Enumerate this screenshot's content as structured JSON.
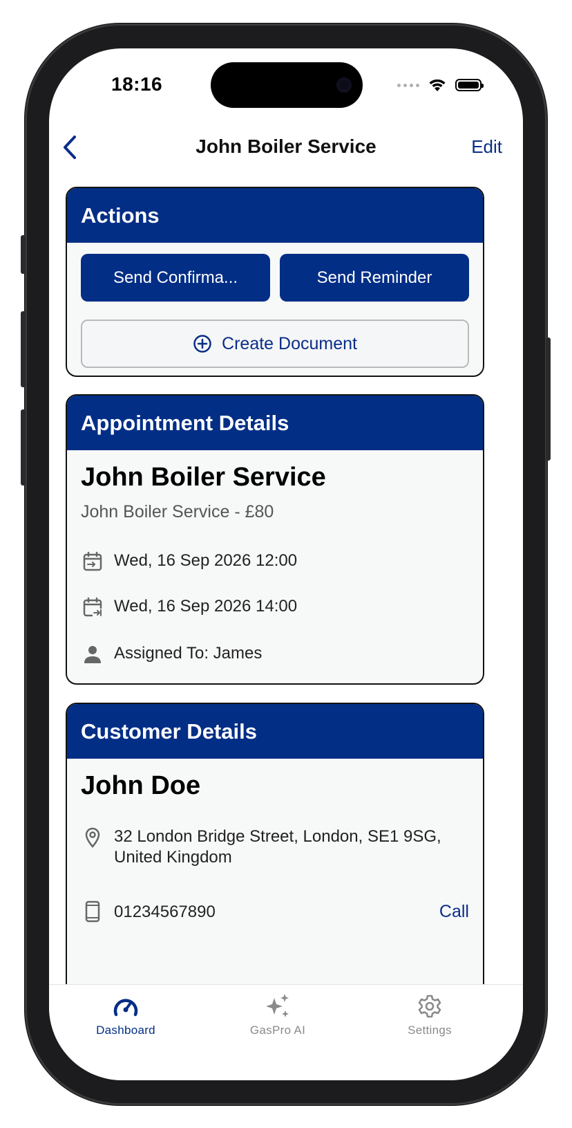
{
  "status_bar": {
    "time": "18:16"
  },
  "nav": {
    "title": "John Boiler Service",
    "edit_label": "Edit"
  },
  "actions": {
    "header": "Actions",
    "send_confirmation_label": "Send Confirma...",
    "send_reminder_label": "Send Reminder",
    "create_document_label": "Create Document"
  },
  "appointment": {
    "header": "Appointment Details",
    "title": "John Boiler Service",
    "subtitle": "John Boiler Service - £80",
    "start": "Wed, 16 Sep 2026  12:00",
    "end": "Wed, 16 Sep 2026  14:00",
    "assigned": "Assigned To: James"
  },
  "customer": {
    "header": "Customer Details",
    "name": "John Doe",
    "address": "32 London Bridge Street, London, SE1 9SG, United Kingdom",
    "phone": "01234567890",
    "call_label": "Call"
  },
  "tabs": [
    {
      "label": "Dashboard",
      "icon": "speedometer-icon",
      "active": true
    },
    {
      "label": "GasPro AI",
      "icon": "sparkles-icon",
      "active": false
    },
    {
      "label": "Settings",
      "icon": "gear-icon",
      "active": false
    }
  ],
  "colors": {
    "brand": "#022e86",
    "accent": "#0a2d87",
    "inactive": "#8a8a8a"
  }
}
